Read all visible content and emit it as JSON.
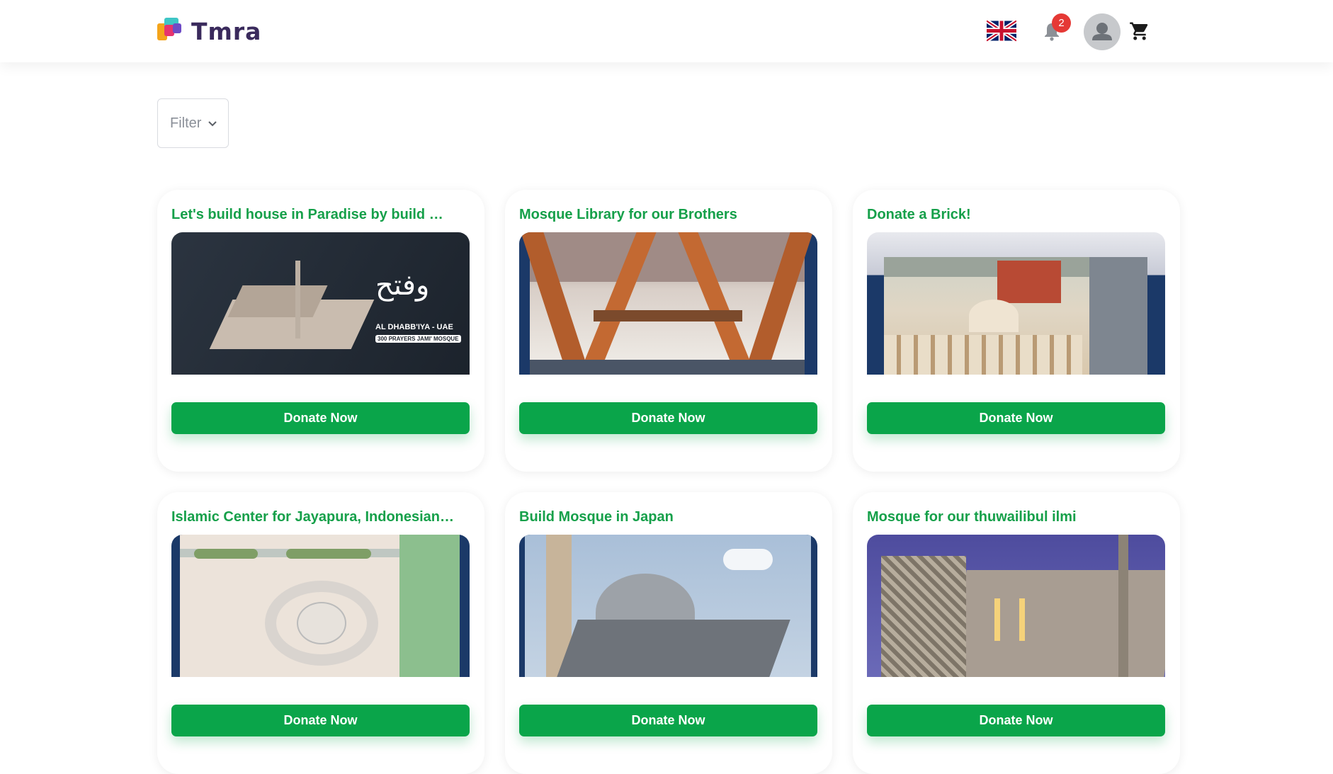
{
  "header": {
    "brand": "Tmra",
    "notifications_count": "2",
    "language_icon": "uk-flag-icon",
    "bell_icon": "bell-icon",
    "profile_icon": "user-avatar-icon",
    "cart_icon": "cart-icon"
  },
  "filter": {
    "label": "Filter",
    "icon": "chevron-down-icon"
  },
  "cards": [
    {
      "title": "Let's build house in Paradise by build Mosque in Al Dhabb'iya - UAE",
      "button": "Donate Now",
      "image_text": {
        "line1": "AL DHABB'IYA - UAE",
        "line2": "300 PRAYERS JAMI' MOSQUE"
      }
    },
    {
      "title": "Mosque Library for our Brothers",
      "button": "Donate Now"
    },
    {
      "title": "Donate a Brick!",
      "button": "Donate Now"
    },
    {
      "title": "Islamic Center for Jayapura, Indonesian Papua",
      "button": "Donate Now"
    },
    {
      "title": "Build Mosque in Japan",
      "button": "Donate Now"
    },
    {
      "title": "Mosque for our thuwailibul ilmi",
      "button": "Donate Now"
    }
  ],
  "colors": {
    "accent": "#0aa54a",
    "title": "#16a04a",
    "badge": "#e53935"
  }
}
